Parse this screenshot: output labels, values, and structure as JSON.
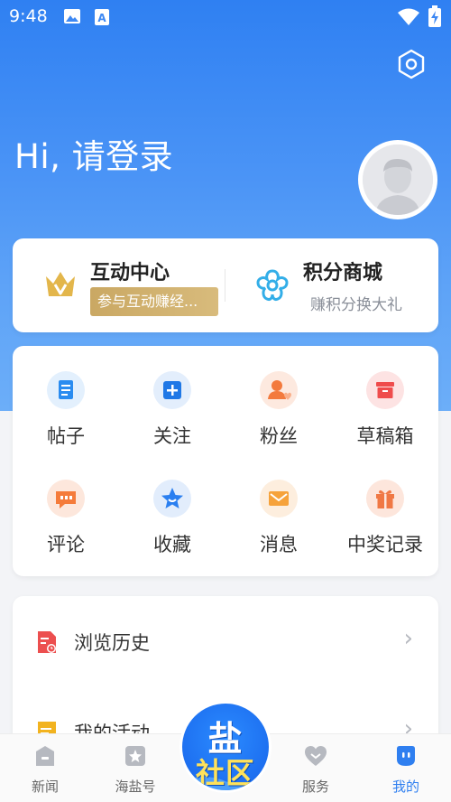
{
  "status_bar": {
    "time": "9:48",
    "icons": [
      "image-icon",
      "a-store-icon",
      "wifi-icon",
      "battery-charging-icon"
    ]
  },
  "header": {
    "greeting": "Hi, 请登录",
    "settings_icon": "hexagon-settings-icon",
    "avatar_icon": "default-avatar-icon"
  },
  "top_card": {
    "interaction": {
      "title": "互动中心",
      "badge": "参与互动赚经...",
      "icon": "gold-crown-icon"
    },
    "points": {
      "title": "积分商城",
      "subtitle": "赚积分换大礼",
      "icon": "flower-outline-icon"
    }
  },
  "grid": {
    "items": [
      {
        "label": "帖子",
        "icon": "document-icon",
        "color": "#2a8cf0",
        "bg": "#e3f0fd"
      },
      {
        "label": "关注",
        "icon": "plus-square-icon",
        "color": "#1f78e6",
        "bg": "#e3eefc"
      },
      {
        "label": "粉丝",
        "icon": "person-heart-icon",
        "color": "#f37a3d",
        "bg": "#fde9df"
      },
      {
        "label": "草稿箱",
        "icon": "drafts-box-icon",
        "color": "#ef4c4c",
        "bg": "#fde3e3"
      },
      {
        "label": "评论",
        "icon": "comment-bubble-icon",
        "color": "#f57b3a",
        "bg": "#fde7dc"
      },
      {
        "label": "收藏",
        "icon": "star-icon",
        "color": "#2a7ff0",
        "bg": "#e2edfc"
      },
      {
        "label": "消息",
        "icon": "envelope-icon",
        "color": "#f6a23a",
        "bg": "#fdeede"
      },
      {
        "label": "中奖记录",
        "icon": "gift-icon",
        "color": "#f07844",
        "bg": "#fde6dc"
      }
    ]
  },
  "list": {
    "items": [
      {
        "label": "浏览历史",
        "icon": "history-doc-icon",
        "color": "#ec4f4f"
      },
      {
        "label": "我的活动",
        "icon": "activity-doc-icon",
        "color": "#f2b31f"
      }
    ]
  },
  "tabbar": {
    "tabs": [
      {
        "label": "新闻",
        "icon": "news-icon"
      },
      {
        "label": "海盐号",
        "icon": "star-box-icon"
      },
      {
        "label": "服务",
        "icon": "heart-icon"
      },
      {
        "label": "我的",
        "icon": "face-bubble-icon"
      }
    ],
    "active": "我的",
    "center": {
      "line1": "盐",
      "line2": "社区"
    }
  },
  "colors": {
    "primary": "#2f7ff0",
    "gold": "#caa863"
  }
}
